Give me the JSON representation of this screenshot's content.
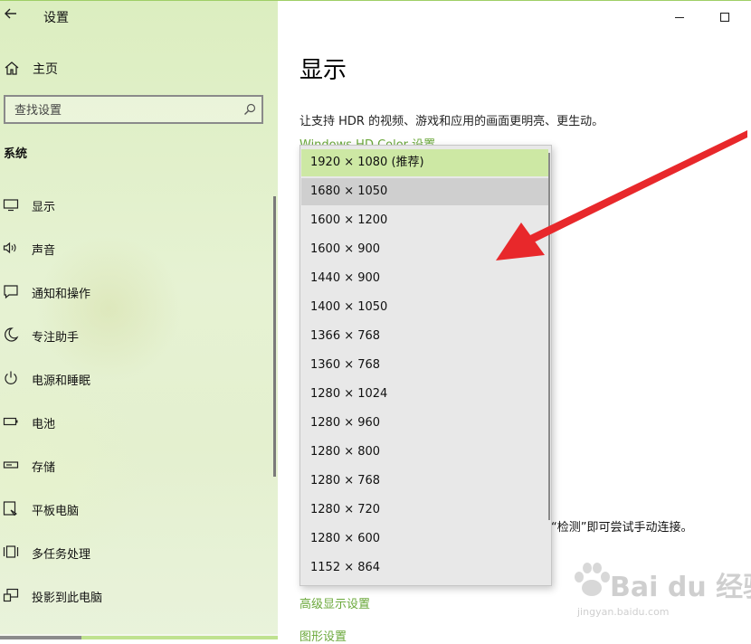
{
  "window": {
    "title": "设置",
    "back_icon": "back-arrow-icon",
    "minimize_icon": "minimize-icon",
    "maximize_icon": "maximize-icon"
  },
  "sidebar": {
    "home_label": "主页",
    "search_placeholder": "查找设置",
    "section_title": "系统",
    "items": [
      {
        "label": "显示",
        "icon": "monitor-icon"
      },
      {
        "label": "声音",
        "icon": "speaker-icon"
      },
      {
        "label": "通知和操作",
        "icon": "notification-icon"
      },
      {
        "label": "专注助手",
        "icon": "moon-icon"
      },
      {
        "label": "电源和睡眠",
        "icon": "power-icon"
      },
      {
        "label": "电池",
        "icon": "battery-icon"
      },
      {
        "label": "存储",
        "icon": "storage-icon"
      },
      {
        "label": "平板电脑",
        "icon": "tablet-icon"
      },
      {
        "label": "多任务处理",
        "icon": "multitask-icon"
      },
      {
        "label": "投影到此电脑",
        "icon": "project-icon"
      }
    ]
  },
  "main": {
    "page_title": "显示",
    "hdr_description": "让支持 HDR 的视频、游戏和应用的画面更明亮、更生动。",
    "hdr_link": "Windows HD Color 设置",
    "detect_text": "“检测”即可尝试手动连接。",
    "advanced_link": "高级显示设置",
    "graphics_link": "图形设置"
  },
  "resolution_dropdown": {
    "selected": "1920 × 1080 (推荐)",
    "hovered": "1680 × 1050",
    "options": [
      "1920 × 1080 (推荐)",
      "1680 × 1050",
      "1600 × 1200",
      "1600 × 900",
      "1440 × 900",
      "1400 × 1050",
      "1366 × 768",
      "1360 × 768",
      "1280 × 1024",
      "1280 × 960",
      "1280 × 800",
      "1280 × 768",
      "1280 × 720",
      "1280 × 600",
      "1152 × 864"
    ]
  },
  "annotation": {
    "arrow_color": "#e8282b"
  },
  "watermark": {
    "text": "Bai du 经验",
    "url": "jingyan.baidu.com"
  },
  "colors": {
    "accent_green": "#6aa83a",
    "selected_row": "#cde8a4",
    "hover_row": "#cfcfcf"
  }
}
